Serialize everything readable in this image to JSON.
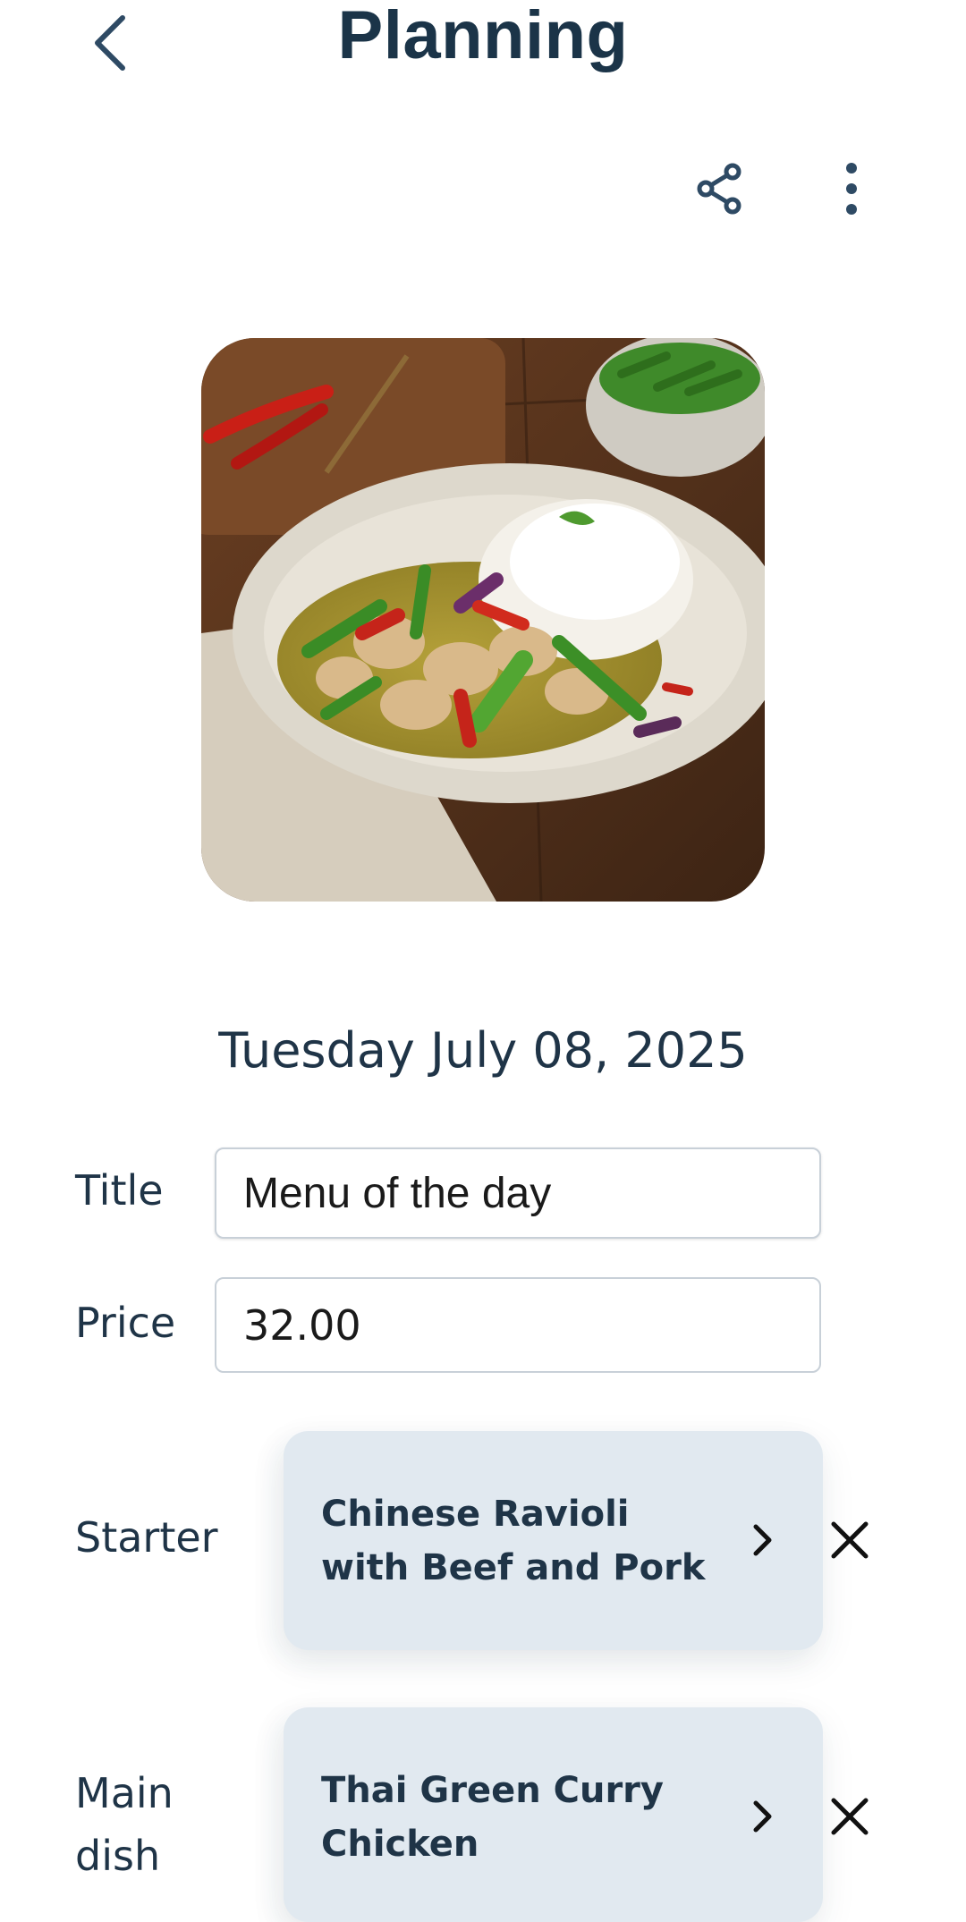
{
  "header": {
    "title": "Planning"
  },
  "date": "Tuesday July 08, 2025",
  "form": {
    "title_label": "Title",
    "title_value": "Menu of the day",
    "price_label": "Price",
    "price_value": "32.00"
  },
  "courses": [
    {
      "label": "Starter",
      "dish": "Chinese Ravioli with Beef and Pork"
    },
    {
      "label_line1": "Main",
      "label_line2": "dish",
      "dish": "Thai Green Curry Chicken"
    }
  ],
  "icons": {
    "back": "chevron-left-icon",
    "share": "share-icon",
    "more": "more-vertical-icon",
    "open": "chevron-right-icon",
    "remove": "close-icon"
  },
  "colors": {
    "text": "#1f3447",
    "card": "#e1e9f0",
    "field_border": "#c8d0d8"
  }
}
